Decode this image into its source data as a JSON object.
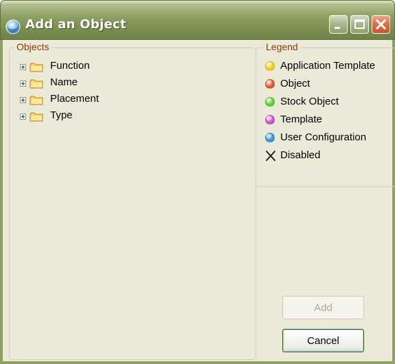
{
  "window": {
    "title": "Add an Object",
    "title_icon": "app-globe-icon",
    "controls": [
      "minimize-icon",
      "maximize-icon",
      "close-icon"
    ]
  },
  "objects": {
    "label": "Objects",
    "items": [
      {
        "label": "Function",
        "icon": "folder-icon"
      },
      {
        "label": "Name",
        "icon": "folder-icon"
      },
      {
        "label": "Placement",
        "icon": "folder-icon"
      },
      {
        "label": "Type",
        "icon": "folder-icon"
      }
    ]
  },
  "legend": {
    "label": "Legend",
    "items": [
      {
        "label": "Application Template",
        "color": "#f2cc1b"
      },
      {
        "label": "Object",
        "color": "#e0562d"
      },
      {
        "label": "Stock Object",
        "color": "#5bcc33"
      },
      {
        "label": "Template",
        "color": "#cc4fc8"
      },
      {
        "label": "User Configuration",
        "color": "#3592d8"
      },
      {
        "label": "Disabled",
        "icon": "x-mark-icon"
      }
    ]
  },
  "buttons": {
    "add": {
      "label": "Add",
      "enabled": false
    },
    "cancel": {
      "label": "Cancel",
      "enabled": true
    }
  }
}
